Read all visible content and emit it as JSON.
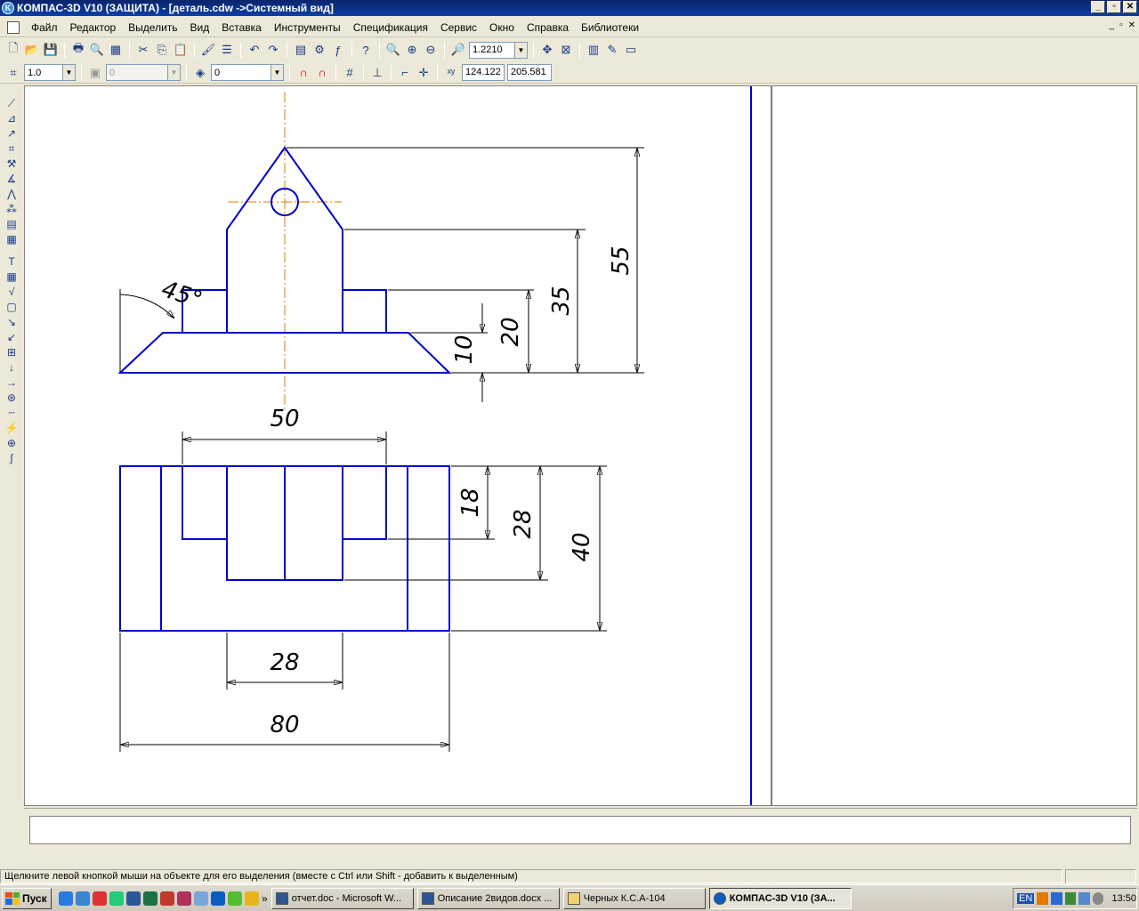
{
  "window": {
    "title": "КОМПАС-3D V10 (ЗАЩИТА) - [деталь.cdw ->Системный вид]",
    "min": "_",
    "restore": "▫",
    "close": "✕"
  },
  "menu": {
    "items": [
      "Файл",
      "Редактор",
      "Выделить",
      "Вид",
      "Вставка",
      "Инструменты",
      "Спецификация",
      "Сервис",
      "Окно",
      "Справка",
      "Библиотеки"
    ]
  },
  "toolbar": {
    "zoom_value": "1.2210",
    "style_value": "1.0",
    "layer_value": "0",
    "layer2_value": "0",
    "coord_x": "124.122",
    "coord_y": "205.581"
  },
  "drawing": {
    "line_color": "#0000cc",
    "axis_color": "#e07a00",
    "dims": {
      "d55": "55",
      "d35": "35",
      "d20": "20",
      "d10": "10",
      "d50": "50",
      "d18": "18",
      "d28_right": "28",
      "d40": "40",
      "d28_bottom": "28",
      "d80": "80",
      "angle": "45°"
    }
  },
  "status": {
    "hint": "Щелкните левой кнопкой мыши на объекте для его выделения (вместе с Ctrl или Shift - добавить к выделенным)"
  },
  "taskbar": {
    "start": "Пуск",
    "tasks": [
      "отчет.doc - Microsoft W...",
      "Описание 2видов.docx ...",
      "Черных К.С.А-104",
      "КОМПАС-3D V10 (ЗА..."
    ],
    "lang": "EN",
    "clock": "13:50",
    "more": "»"
  }
}
